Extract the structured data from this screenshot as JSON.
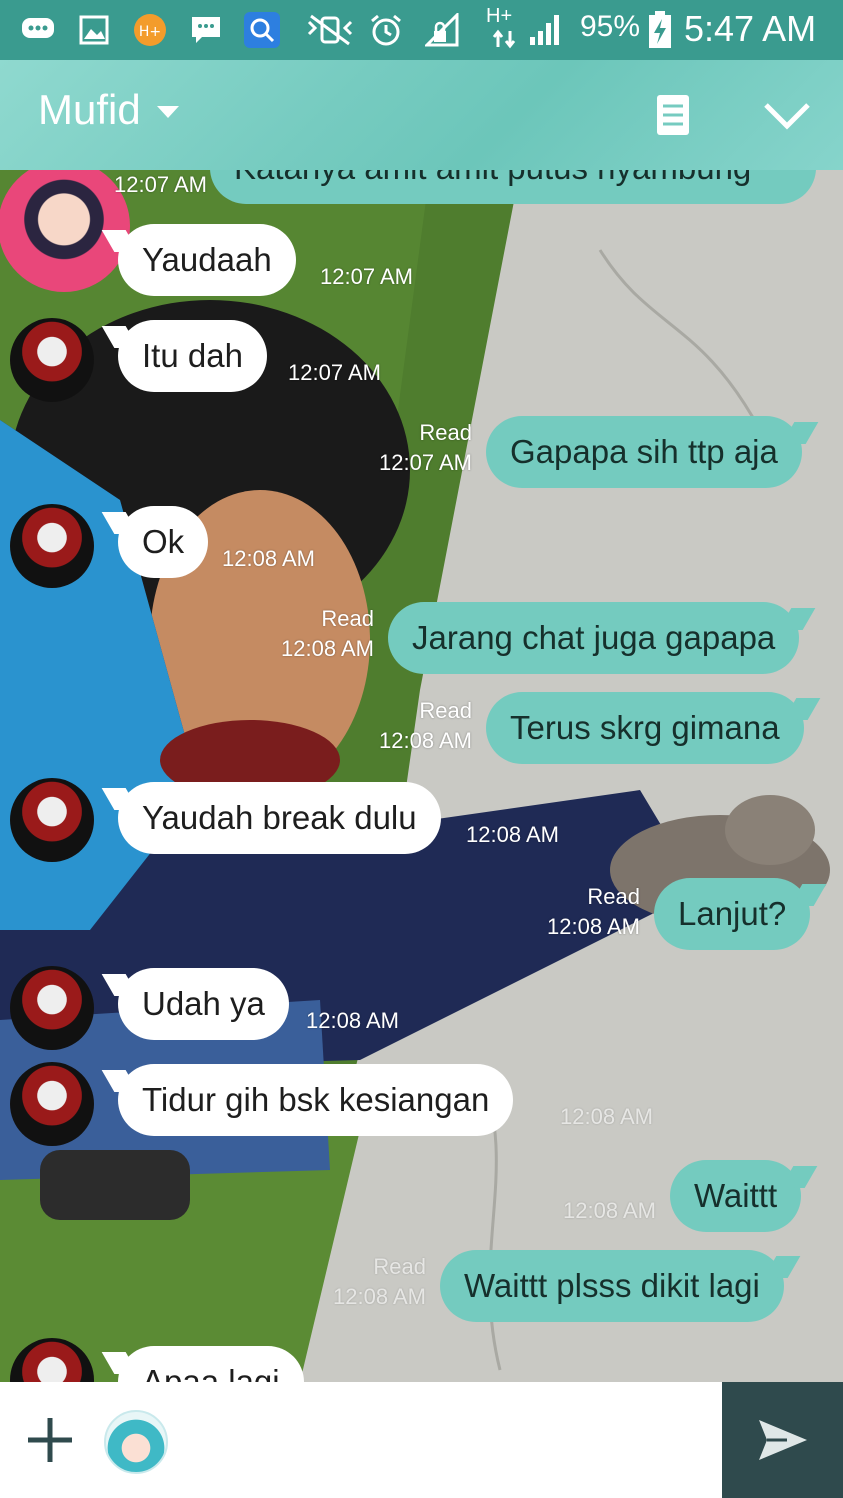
{
  "status_bar": {
    "battery": "95%",
    "time": "5:47 AM",
    "network": "H+",
    "network_badge": "H+"
  },
  "header": {
    "contact_name": "Mufid"
  },
  "messages": [
    {
      "text": "Katanya amit amit putus nyambung",
      "direction": "out",
      "time": "12:07 AM"
    },
    {
      "text": "Yaudaah",
      "direction": "in",
      "time": "12:07 AM"
    },
    {
      "text": "Itu dah",
      "direction": "in",
      "time": "12:07 AM"
    },
    {
      "text": "Gapapa sih ttp aja",
      "direction": "out",
      "status": "Read",
      "time": "12:07 AM"
    },
    {
      "text": "Ok",
      "direction": "in",
      "time": "12:08 AM"
    },
    {
      "text": "Jarang chat juga gapapa",
      "direction": "out",
      "status": "Read",
      "time": "12:08 AM"
    },
    {
      "text": "Terus skrg gimana",
      "direction": "out",
      "status": "Read",
      "time": "12:08 AM"
    },
    {
      "text": "Yaudah break dulu",
      "direction": "in",
      "time": "12:08 AM"
    },
    {
      "text": "Lanjut?",
      "direction": "out",
      "status": "Read",
      "time": "12:08 AM"
    },
    {
      "text": "Udah ya",
      "direction": "in",
      "time": "12:08 AM"
    },
    {
      "text": "Tidur gih bsk kesiangan",
      "direction": "in",
      "time": "12:08 AM"
    },
    {
      "text": "Waittt",
      "direction": "out",
      "time": "12:08 AM"
    },
    {
      "text": "Waittt plsss dikit lagi",
      "direction": "out",
      "status": "Read",
      "time": "12:08 AM"
    },
    {
      "text": "Apaa lagi",
      "direction": "in"
    }
  ],
  "input": {
    "placeholder": "",
    "value": ""
  },
  "icons": {
    "add": "plus-icon",
    "sticker": "sticker-icon",
    "send": "send-icon",
    "menu": "notes-icon",
    "collapse": "chevron-down-icon"
  },
  "colors": {
    "status_bar": "#3a9b8f",
    "header": "#76cbc0",
    "outgoing_bubble": "#74cbbf",
    "incoming_bubble": "#ffffff",
    "send_button": "#2f4a4d"
  }
}
